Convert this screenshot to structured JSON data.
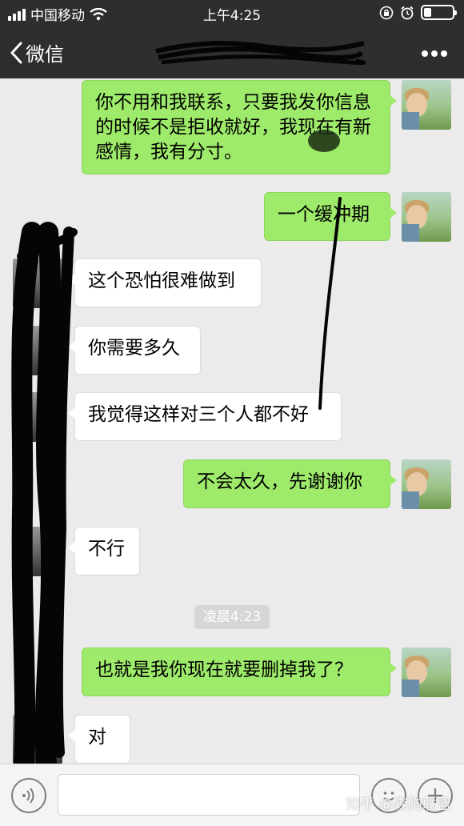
{
  "status_bar": {
    "carrier": "中国移动",
    "time": "上午4:25",
    "battery_level": 0.25
  },
  "nav": {
    "back_label": "微信",
    "title": "",
    "more_icon": "more-dots-icon"
  },
  "messages": [
    {
      "side": "out",
      "text": "你不用和我联系，只要我发你信息的时候不是拒收就好，我现在有新感情，我有分寸。"
    },
    {
      "side": "out",
      "text": "一个缓冲期"
    },
    {
      "side": "in",
      "text": "这个恐怕很难做到"
    },
    {
      "side": "in",
      "text": "你需要多久"
    },
    {
      "side": "in",
      "text": "我觉得这样对三个人都不好"
    },
    {
      "side": "out",
      "text": "不会太久，先谢谢你"
    },
    {
      "side": "in",
      "text": "不行"
    },
    {
      "side": "out",
      "text": "也就是我你现在就要删掉我了？"
    },
    {
      "side": "in",
      "text": "对"
    }
  ],
  "timestamp": "凌晨4:23",
  "input_bar": {
    "placeholder": "",
    "voice_icon": "voice-icon",
    "emoji_icon": "emoji-icon",
    "plus_icon": "plus-icon"
  },
  "watermark": "知乎 @森狗联盟",
  "colors": {
    "header_bg": "#2e2e2e",
    "chat_bg": "#ebebeb",
    "outgoing_bubble": "#9eea6a",
    "incoming_bubble": "#ffffff"
  }
}
